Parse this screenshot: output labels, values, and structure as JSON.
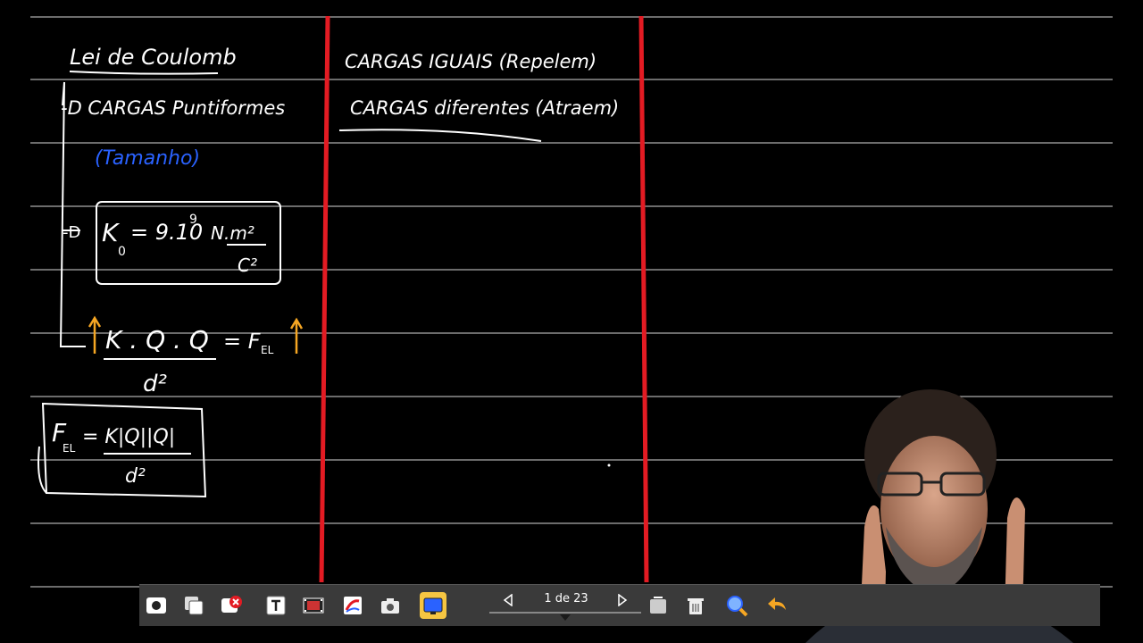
{
  "board": {
    "background": "#000000",
    "rule_color": "#ffffff",
    "divider_color": "#e31b23",
    "title": "Lei de Coulomb",
    "item1": "-D CARGAS Puntiformes",
    "item1_note": "(Tamanho)",
    "item2_arrow": "-D",
    "k_constant": "K₀ = 9.10⁹ N.m²/C²",
    "k_lhs": "K",
    "k_sub": "0",
    "k_value": "= 9.10",
    "k_exp": "9",
    "k_unit_num": "N.m²",
    "k_unit_den": "C²",
    "formula_num": "K . Q . Q",
    "formula_den": "d²",
    "formula_rhs": "= F",
    "formula_rhs_sub": "EL",
    "boxed_lhs": "F",
    "boxed_lhs_sub": "EL",
    "boxed_num": "= K|Q||Q|",
    "boxed_den": "d²",
    "col2_line1": "CARGAS IGUAIS (Repelem)",
    "col2_line2": "CARGAS diferentes (Atraem)",
    "note_color": "#2a62ff",
    "accent_color": "#f5a623"
  },
  "toolbar": {
    "buttons": [
      {
        "name": "record-icon"
      },
      {
        "name": "copy-pages-icon"
      },
      {
        "name": "close-record-icon"
      },
      {
        "name": "text-tool-icon"
      },
      {
        "name": "film-icon"
      },
      {
        "name": "paint-icon"
      },
      {
        "name": "camera-icon"
      },
      {
        "name": "screen-icon"
      }
    ],
    "page_label": "1 de 23",
    "right_buttons": [
      {
        "name": "clear-icon"
      },
      {
        "name": "trash-icon"
      },
      {
        "name": "zoom-icon"
      },
      {
        "name": "undo-icon"
      }
    ]
  }
}
